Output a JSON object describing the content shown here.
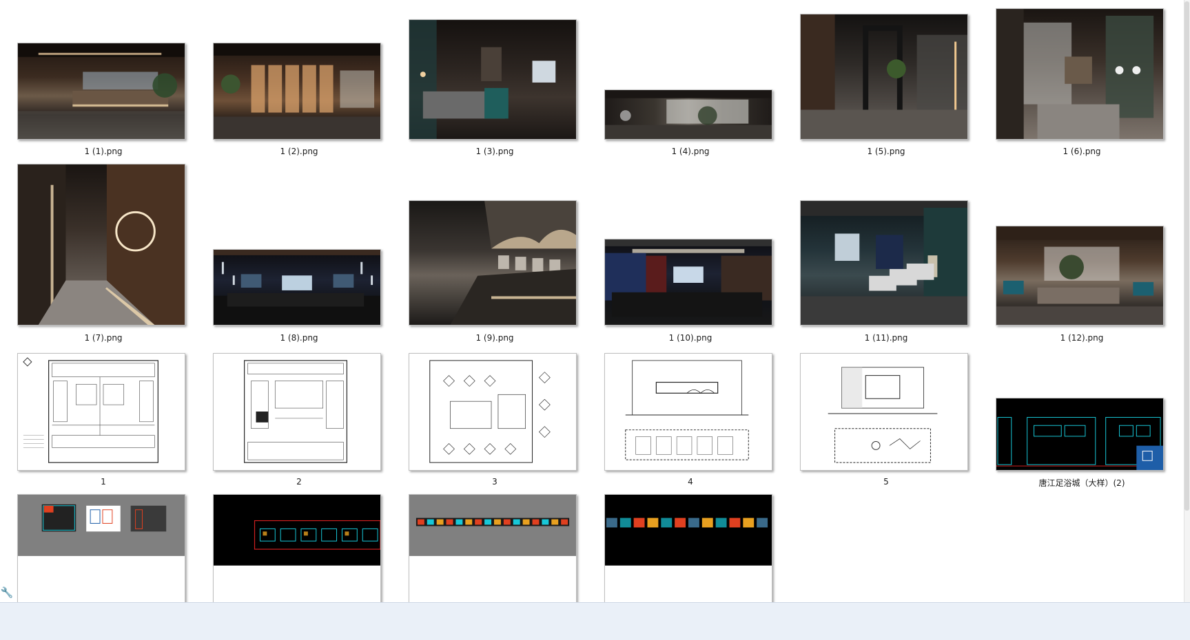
{
  "files": [
    {
      "name": "1 (1).png"
    },
    {
      "name": "1 (2).png"
    },
    {
      "name": "1 (3).png"
    },
    {
      "name": "1 (4).png"
    },
    {
      "name": "1 (5).png"
    },
    {
      "name": "1 (6).png"
    },
    {
      "name": "1 (7).png"
    },
    {
      "name": "1 (8).png"
    },
    {
      "name": "1 (9).png"
    },
    {
      "name": "1 (10).png"
    },
    {
      "name": "1 (11).png"
    },
    {
      "name": "1 (12).png"
    },
    {
      "name": "1"
    },
    {
      "name": "2"
    },
    {
      "name": "3"
    },
    {
      "name": "4"
    },
    {
      "name": "5"
    },
    {
      "name": "唐江足浴城（大样）(2)"
    },
    {
      "name": ""
    },
    {
      "name": ""
    },
    {
      "name": ""
    },
    {
      "name": ""
    }
  ],
  "icons": {
    "status_tool": "wrench-icon"
  }
}
